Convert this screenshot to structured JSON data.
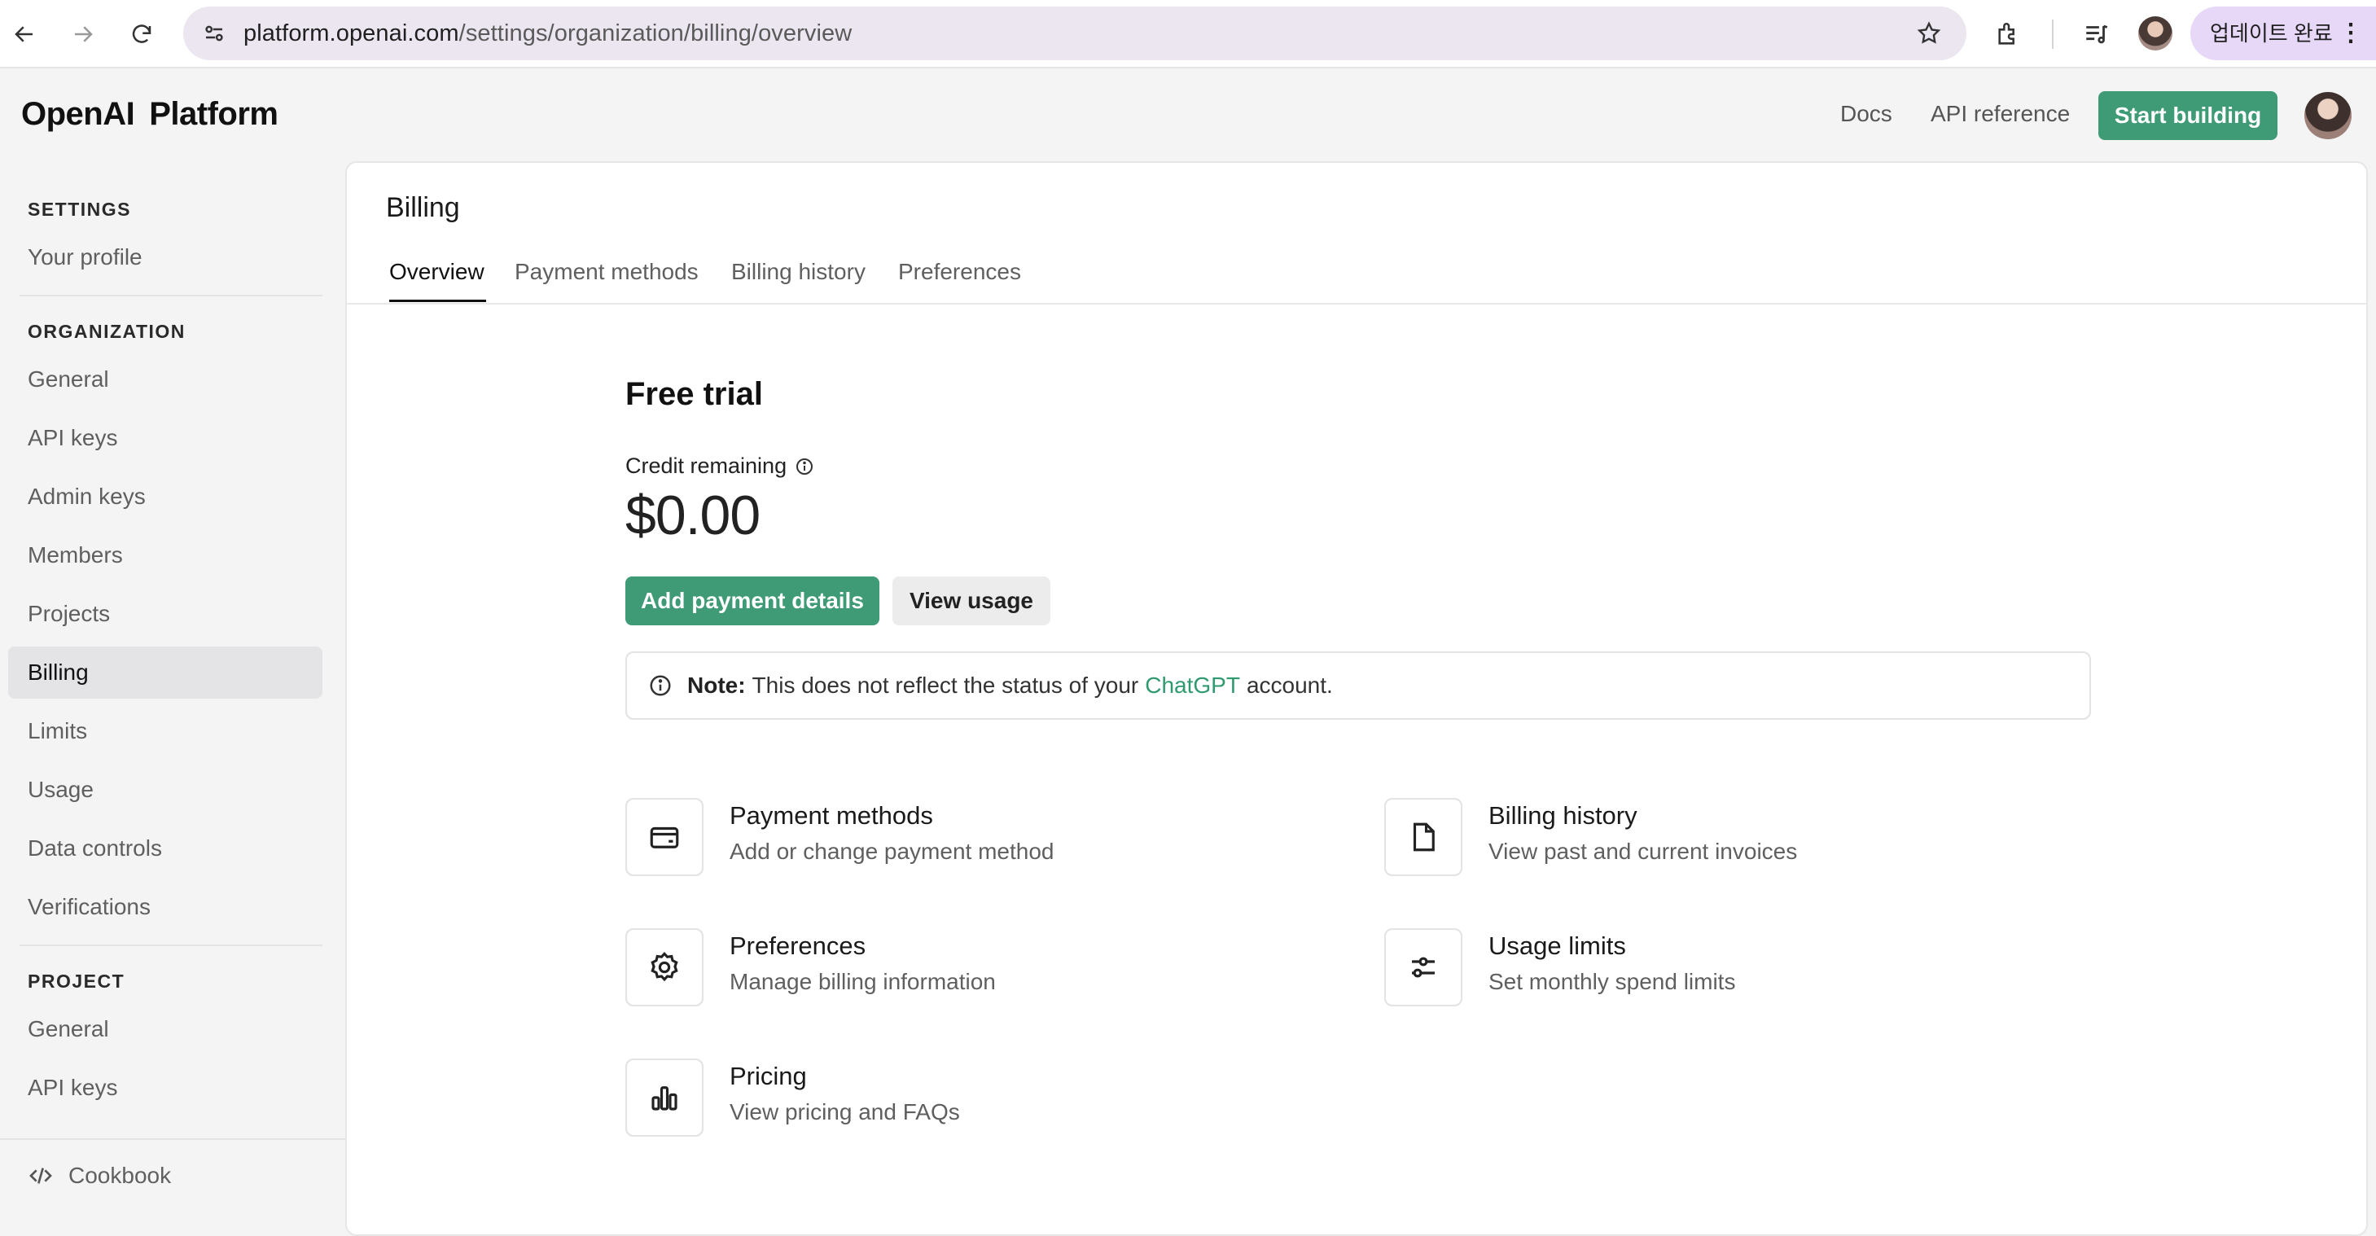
{
  "browser": {
    "url_host": "platform.openai.com",
    "url_path": "/settings/organization/billing/overview",
    "update_label": "업데이트 완료",
    "update_menu": "⋮"
  },
  "header": {
    "logo_openai": "OpenAI",
    "logo_platform": "Platform",
    "docs": "Docs",
    "api_reference": "API reference",
    "start_building": "Start building"
  },
  "sidebar": {
    "settings_heading": "SETTINGS",
    "your_profile": "Your profile",
    "organization_heading": "ORGANIZATION",
    "org_items": [
      "General",
      "API keys",
      "Admin keys",
      "Members",
      "Projects",
      "Billing",
      "Limits",
      "Usage",
      "Data controls",
      "Verifications"
    ],
    "project_heading": "PROJECT",
    "project_items": [
      "General",
      "API keys"
    ],
    "cookbook": "Cookbook"
  },
  "main": {
    "title": "Billing",
    "tabs": [
      "Overview",
      "Payment methods",
      "Billing history",
      "Preferences"
    ],
    "plan": "Free trial",
    "credit_label": "Credit remaining",
    "credit_value": "$0.00",
    "add_payment": "Add payment details",
    "view_usage": "View usage",
    "note_bold": "Note:",
    "note_text": "This does not reflect the status of your",
    "note_link": "ChatGPT",
    "note_end": "account.",
    "cards": [
      {
        "title": "Payment methods",
        "sub": "Add or change payment method",
        "icon": "credit-card-icon"
      },
      {
        "title": "Billing history",
        "sub": "View past and current invoices",
        "icon": "file-icon"
      },
      {
        "title": "Preferences",
        "sub": "Manage billing information",
        "icon": "gear-icon"
      },
      {
        "title": "Usage limits",
        "sub": "Set monthly spend limits",
        "icon": "sliders-icon"
      },
      {
        "title": "Pricing",
        "sub": "View pricing and FAQs",
        "icon": "bar-chart-icon"
      }
    ]
  },
  "colors": {
    "accent_green": "#3e9b75",
    "link_green": "#2f9a6f",
    "update_pill": "#e6d8f6"
  }
}
